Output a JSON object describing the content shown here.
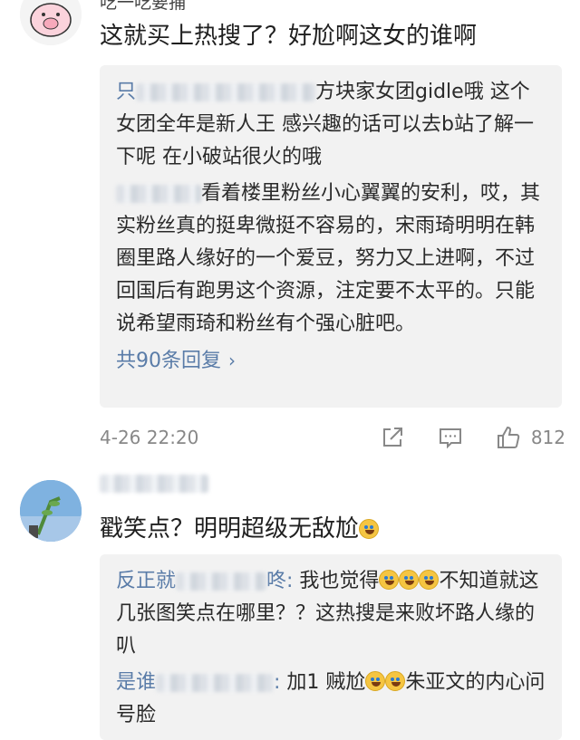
{
  "comments": [
    {
      "username": "吃一吃要捕",
      "text": "这就买上热搜了？好尬啊这女的谁啊",
      "replies": [
        {
          "name": "只",
          "text": "方块家女团gidle哦 这个女团全年是新人王 感兴趣的话可以去b站了解一下呢 在小破站很火的哦"
        },
        {
          "name": "",
          "text": "看着楼里粉丝小心翼翼的安利，哎，其实粉丝真的挺卑微挺不容易的，宋雨琦明明在韩圈里路人缘好的一个爱豆，努力又上进啊，不过回国后有跑男这个资源，注定要不太平的。只能说希望雨琦和粉丝有个强心脏吧。"
        }
      ],
      "more_replies": "共90条回复",
      "time": "4-26 22:20",
      "like_count": "812"
    },
    {
      "username": "",
      "text": "戳笑点？明明超级无敌尬",
      "replies": [
        {
          "name": "反正就",
          "suffix": "咚:",
          "text_a": " 我也觉得",
          "text_b": "不知道就这几张图笑点在哪里？？这热搜是来败坏路人缘的叭"
        },
        {
          "name": "是谁",
          "suffix": ":",
          "text_a": " 加1 贼尬",
          "text_b": "朱亚文的内心问号脸"
        }
      ]
    }
  ],
  "icons": {
    "share": "share-icon",
    "comment": "comment-icon",
    "like": "thumbs-up-icon",
    "more": "chevron-right-icon"
  },
  "colors": {
    "link": "#5a7ca8",
    "reply_bg": "#f2f2f2",
    "meta": "#888888"
  }
}
